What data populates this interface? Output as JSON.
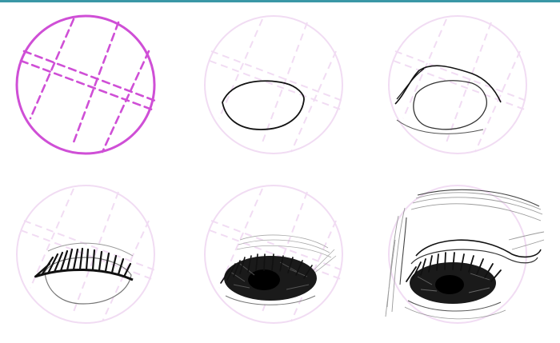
{
  "colors": {
    "top_rule": "#3a97a6",
    "guide_strong": "#cf4fd6",
    "guide_faint": "#f1dcf3",
    "ink": "#111111",
    "sketch_grey": "#9a9a9a"
  },
  "panels": [
    {
      "step": 1,
      "content": "guide-circle-with-construction-lines"
    },
    {
      "step": 2,
      "content": "eye-outline"
    },
    {
      "step": 3,
      "content": "eyelid-crease"
    },
    {
      "step": 4,
      "content": "upper-eyelashes"
    },
    {
      "step": 5,
      "content": "shaded-iris"
    },
    {
      "step": 6,
      "content": "finished-eye-with-brow"
    }
  ]
}
